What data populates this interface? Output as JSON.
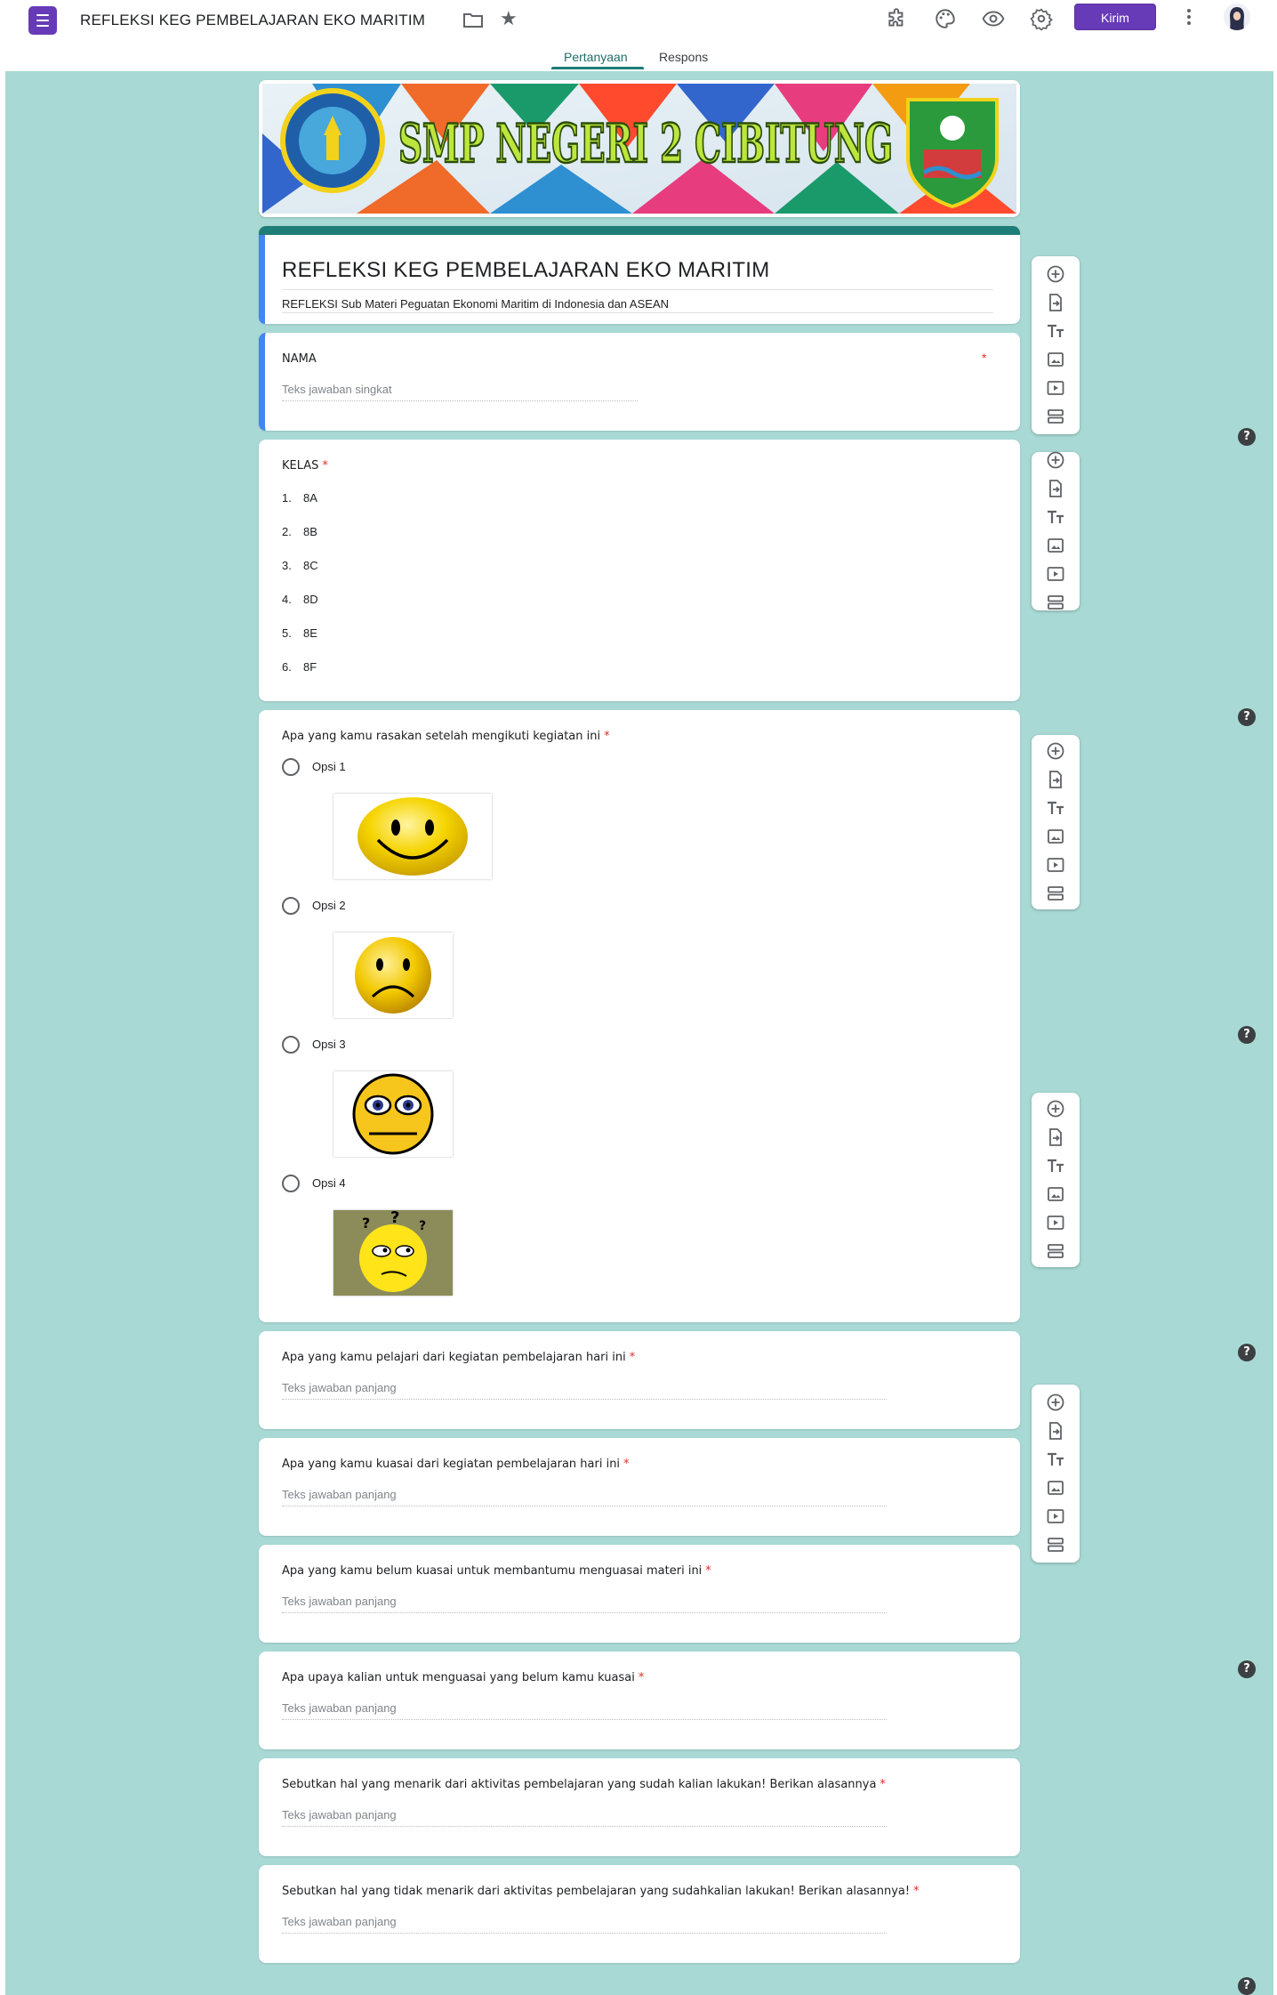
{
  "header": {
    "doc_title": "REFLEKSI KEG PEMBELAJARAN EKO MARITIM",
    "send_label": "Kirim",
    "icons": [
      "addons-icon",
      "palette-icon",
      "preview-icon",
      "settings-icon",
      "more-icon"
    ]
  },
  "tabs": [
    {
      "label": "Pertanyaan",
      "active": true
    },
    {
      "label": "Respons",
      "active": false
    }
  ],
  "banner": {
    "school_name": "SMP NEGERI 2 CIBITUNG"
  },
  "form": {
    "title": "REFLEKSI KEG PEMBELAJARAN EKO MARITIM",
    "description": "REFLEKSI Sub Materi Peguatan Ekonomi Maritim di Indonesia dan ASEAN"
  },
  "questions": {
    "nama": {
      "title": "NAMA",
      "required": "*",
      "placeholder": "Teks jawaban singkat"
    },
    "kelas": {
      "title": "KELAS",
      "required": "*",
      "options": [
        {
          "num": "1.",
          "label": "8A"
        },
        {
          "num": "2.",
          "label": "8B"
        },
        {
          "num": "3.",
          "label": "8C"
        },
        {
          "num": "4.",
          "label": "8D"
        },
        {
          "num": "5.",
          "label": "8E"
        },
        {
          "num": "6.",
          "label": "8F"
        }
      ]
    },
    "perasaan": {
      "title": "Apa yang kamu rasakan setelah mengikuti kegiatan ini",
      "required": "*",
      "options": [
        {
          "label": "Opsi 1",
          "image": "happy-face"
        },
        {
          "label": "Opsi 2",
          "image": "sad-face"
        },
        {
          "label": "Opsi 3",
          "image": "neutral-face"
        },
        {
          "label": "Opsi 4",
          "image": "confused-face"
        }
      ]
    },
    "paragraphs": [
      {
        "title": "Apa yang kamu pelajari dari kegiatan pembelajaran hari ini",
        "required": "*",
        "placeholder": "Teks jawaban panjang"
      },
      {
        "title": "Apa yang kamu kuasai dari kegiatan pembelajaran hari ini",
        "required": "*",
        "placeholder": "Teks jawaban panjang"
      },
      {
        "title": "Apa yang kamu belum kuasai untuk membantumu menguasai materi ini",
        "required": "*",
        "placeholder": "Teks jawaban panjang"
      },
      {
        "title": "Apa upaya kalian untuk menguasai yang belum kamu kuasai",
        "required": "*",
        "placeholder": "Teks jawaban panjang"
      },
      {
        "title": "Sebutkan hal yang menarik dari aktivitas pembelajaran yang sudah kalian lakukan! Berikan alasannya",
        "required": "*",
        "placeholder": "Teks jawaban panjang"
      },
      {
        "title": "Sebutkan hal yang tidak menarik dari aktivitas pembelajaran yang sudahkalian lakukan! Berikan alasannya!",
        "required": "*",
        "placeholder": "Teks jawaban panjang"
      }
    ]
  },
  "toolbar_icons": [
    "add-question-icon",
    "import-questions-icon",
    "add-title-icon",
    "add-image-icon",
    "add-video-icon",
    "add-section-icon"
  ],
  "help_label": "?",
  "colors": {
    "theme": "#a8d9d5",
    "accent": "#1e7d76",
    "brand": "#673ab7",
    "active_edge": "#4285f4",
    "required": "#d93025"
  }
}
